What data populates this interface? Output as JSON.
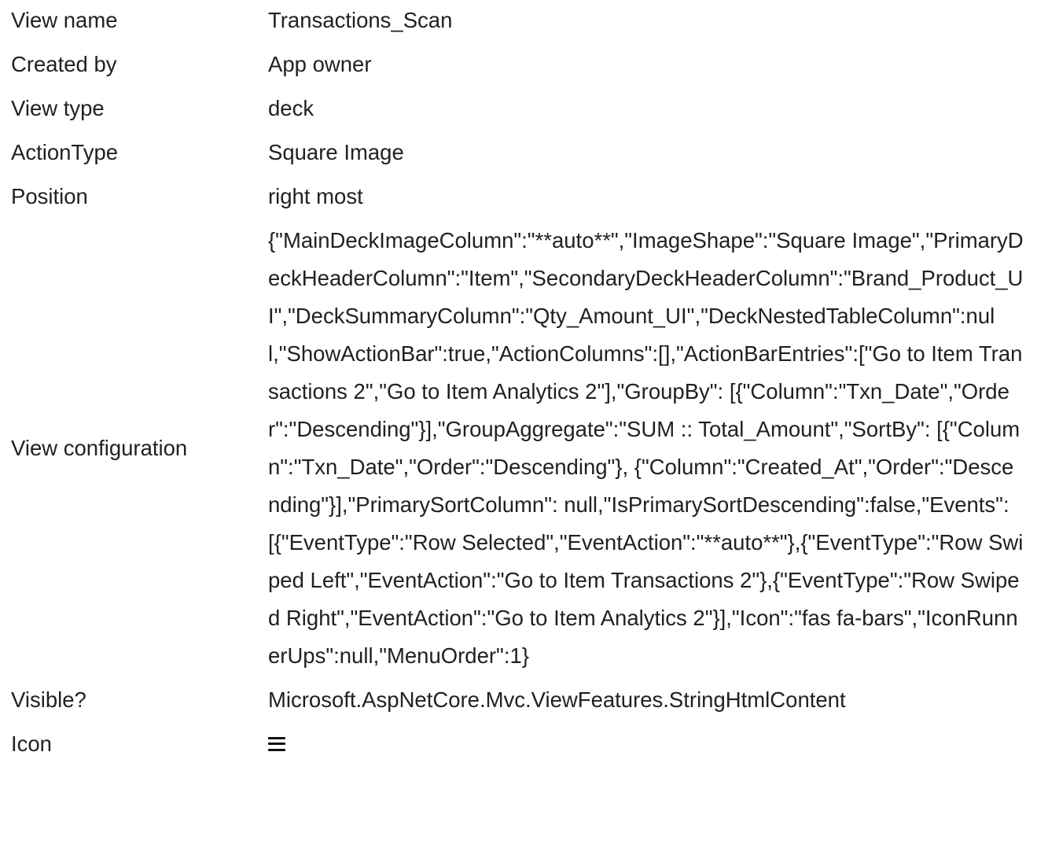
{
  "properties": [
    {
      "label": "View name",
      "value": "Transactions_Scan"
    },
    {
      "label": "Created by",
      "value": "App owner"
    },
    {
      "label": "View type",
      "value": "deck"
    },
    {
      "label": "ActionType",
      "value": "Square Image"
    },
    {
      "label": "Position",
      "value": "right most"
    },
    {
      "label": "View configuration",
      "value": "{\"MainDeckImageColumn\":\"**auto**\",\"ImageShape\":\"Square Image\",\"PrimaryDeckHeaderColumn\":\"Item\",\"SecondaryDeckHeaderColumn\":\"Brand_Product_UI\",\"DeckSummaryColumn\":\"Qty_Amount_UI\",\"DeckNestedTableColumn\":null,\"ShowActionBar\":true,\"ActionColumns\":[],\"ActionBarEntries\":[\"Go to Item Transactions 2\",\"Go to Item Analytics 2\"],\"GroupBy\": [{\"Column\":\"Txn_Date\",\"Order\":\"Descending\"}],\"GroupAggregate\":\"SUM :: Total_Amount\",\"SortBy\": [{\"Column\":\"Txn_Date\",\"Order\":\"Descending\"}, {\"Column\":\"Created_At\",\"Order\":\"Descending\"}],\"PrimarySortColumn\": null,\"IsPrimarySortDescending\":false,\"Events\":[{\"EventType\":\"Row Selected\",\"EventAction\":\"**auto**\"},{\"EventType\":\"Row Swiped Left\",\"EventAction\":\"Go to Item Transactions 2\"},{\"EventType\":\"Row Swiped Right\",\"EventAction\":\"Go to Item Analytics 2\"}],\"Icon\":\"fas fa-bars\",\"IconRunnerUps\":null,\"MenuOrder\":1}"
    },
    {
      "label": "Visible?",
      "value": "Microsoft.AspNetCore.Mvc.ViewFeatures.StringHtmlContent"
    },
    {
      "label": "Icon",
      "icon": "bars-icon"
    }
  ]
}
